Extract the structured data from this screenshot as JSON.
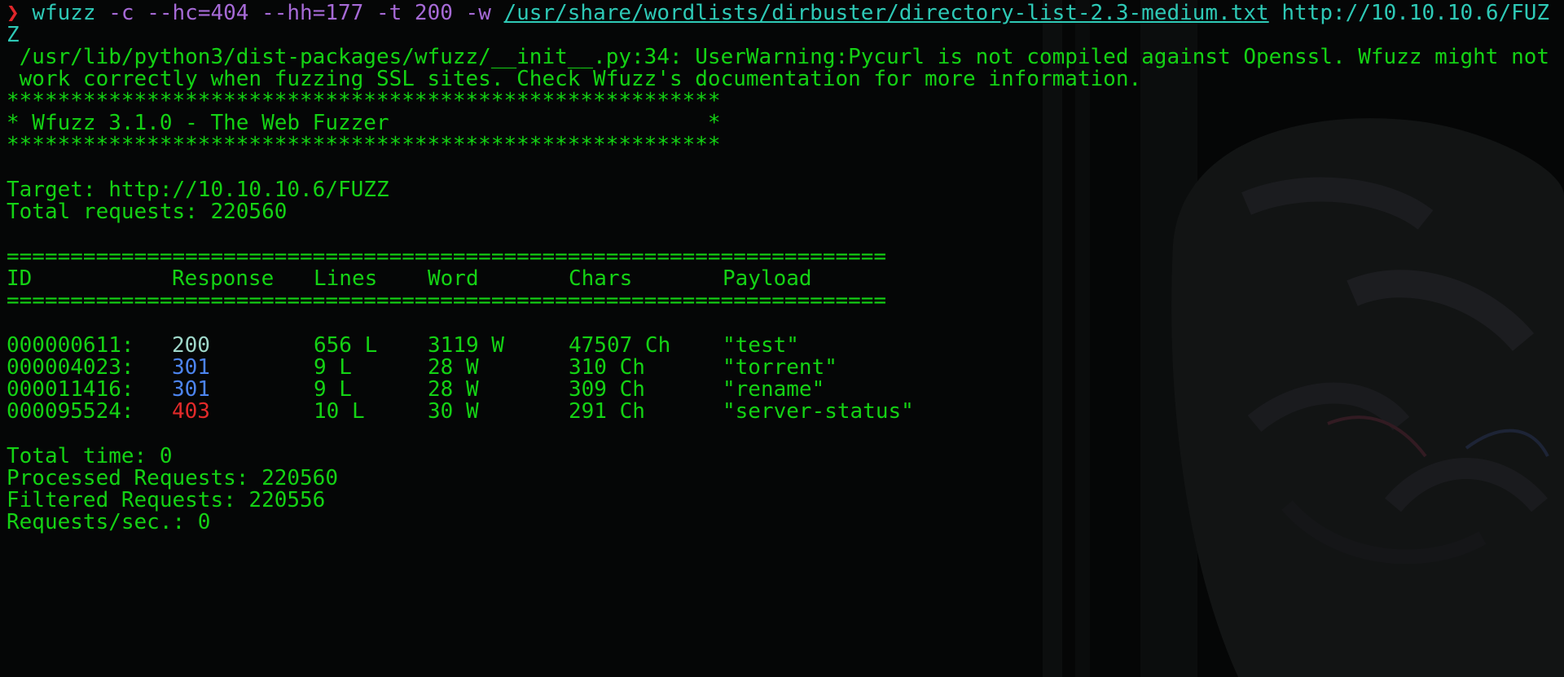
{
  "theme": {
    "foreground": "#14d214",
    "background": "#050606",
    "accent_red": "#e0262a",
    "accent_cyan": "#2ec9b6",
    "accent_purple": "#a66ad6",
    "status_301": "#4c84ee",
    "status_403": "#e22a2a",
    "status_200": "#9fd7c9"
  },
  "command": {
    "prompt_symbol": "❯",
    "program": "wfuzz",
    "args_prefix": " -c --hc=404 --hh=177 -t 200 -w ",
    "wordlist": "/usr/share/wordlists/dirbuster/directory-list-2.3-medium.txt",
    "url_part1": "http://10.10.10.6/FUZ",
    "url_part2": "Z"
  },
  "warning": {
    "line1": " /usr/lib/python3/dist-packages/wfuzz/__init__.py:34: UserWarning:Pycurl is not compiled against Openssl. Wfuzz might not",
    "line2": " work correctly when fuzzing SSL sites. Check Wfuzz's documentation for more information."
  },
  "banner": {
    "stars": "********************************************************",
    "title": "* Wfuzz 3.1.0 - The Web Fuzzer                         *"
  },
  "target": {
    "target_line": "Target: http://10.10.10.6/FUZZ",
    "total_requests_line": "Total requests: 220560"
  },
  "results": {
    "separator": "=====================================================================",
    "headers": {
      "id": "ID",
      "response": "Response",
      "lines": "Lines",
      "word": "Word",
      "chars": "Chars",
      "payload": "Payload"
    },
    "rows": [
      {
        "id": "000000611:",
        "response": "200",
        "lines": "656 L",
        "word": "3119 W",
        "chars": "47507 Ch",
        "payload": "\"test\""
      },
      {
        "id": "000004023:",
        "response": "301",
        "lines": "9 L",
        "word": "28 W",
        "chars": "310 Ch",
        "payload": "\"torrent\""
      },
      {
        "id": "000011416:",
        "response": "301",
        "lines": "9 L",
        "word": "28 W",
        "chars": "309 Ch",
        "payload": "\"rename\""
      },
      {
        "id": "000095524:",
        "response": "403",
        "lines": "10 L",
        "word": "30 W",
        "chars": "291 Ch",
        "payload": "\"server-status\""
      }
    ]
  },
  "summary": {
    "total_time": "Total time: 0",
    "processed": "Processed Requests: 220560",
    "filtered": "Filtered Requests: 220556",
    "rate": "Requests/sec.: 0"
  }
}
